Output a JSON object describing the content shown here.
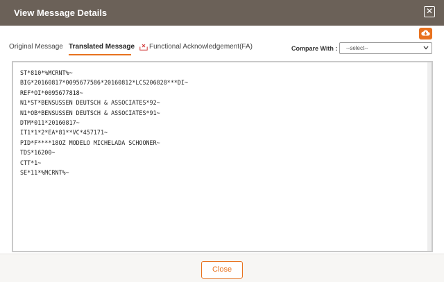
{
  "dialog": {
    "title": "View Message Details"
  },
  "tabs": [
    {
      "label": "Original Message"
    },
    {
      "label": "Translated Message"
    },
    {
      "label": "Functional Acknowledgement(FA)"
    }
  ],
  "compare": {
    "label": "Compare With :",
    "selected": "--select--"
  },
  "message_lines": [
    "ST*810*%MCRNT%~",
    "BIG*20160817*0095677586*20160812*LCS206828***DI~",
    "REF*OI*0095677818~",
    "N1*ST*BENSUSSEN DEUTSCH & ASSOCIATES*92~",
    "N1*OB*BENSUSSEN DEUTSCH & ASSOCIATES*91~",
    "DTM*011*20160817~",
    "IT1*1*2*EA*81**VC*457171~",
    "PID*F****18OZ MODELO MICHELADA SCHOONER~",
    "TDS*16200~",
    "CTT*1~",
    "SE*11*%MCRNT%~"
  ],
  "footer": {
    "close_label": "Close"
  },
  "colors": {
    "titlebar": "#6b6158",
    "accent": "#e8721f"
  },
  "icons": {
    "close": "close-icon",
    "download": "cloud-download-icon",
    "fa_status": "error-envelope-icon",
    "select_caret": "chevron-down-icon"
  }
}
